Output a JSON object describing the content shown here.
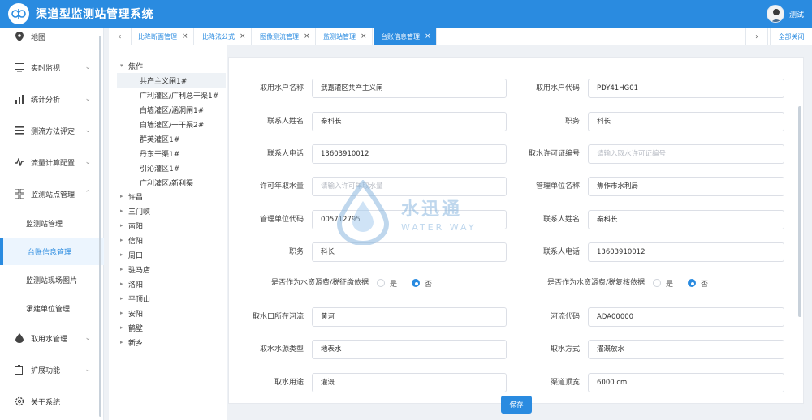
{
  "header": {
    "title": "渠道型监测站管理系统",
    "user_name": "测试"
  },
  "sidebar": {
    "items": [
      {
        "label": "地图",
        "icon": "map-pin-icon"
      },
      {
        "label": "实时监视",
        "icon": "monitor-icon"
      },
      {
        "label": "统计分析",
        "icon": "chart-icon"
      },
      {
        "label": "测流方法评定",
        "icon": "list-icon"
      },
      {
        "label": "流量计算配置",
        "icon": "wave-icon"
      },
      {
        "label": "监测站点管理",
        "icon": "grid-icon"
      },
      {
        "label": "取用水管理",
        "icon": "drop-icon"
      },
      {
        "label": "扩展功能",
        "icon": "extension-icon"
      },
      {
        "label": "关于系统",
        "icon": "gear-icon"
      }
    ],
    "sub_items": [
      {
        "label": "监测站管理"
      },
      {
        "label": "台账信息管理"
      },
      {
        "label": "监测站现场图片"
      },
      {
        "label": "承建单位管理"
      }
    ]
  },
  "tabs": {
    "items": [
      {
        "label": "比降断面管理"
      },
      {
        "label": "比降法公式"
      },
      {
        "label": "图像测流管理"
      },
      {
        "label": "监测站管理"
      },
      {
        "label": "台账信息管理"
      }
    ],
    "close_all": "全部关闭"
  },
  "tree": {
    "root": "焦作",
    "children": [
      "共产主义闸1#",
      "广利灌区/广利总干渠1#",
      "白墙灌区/涵洞闸1#",
      "白墙灌区/一干渠2#",
      "群英灌区1#",
      "丹东干渠1#",
      "引沁灌区1#",
      "广利灌区/新利渠"
    ],
    "others": [
      "许昌",
      "三门峡",
      "南阳",
      "信阳",
      "周口",
      "驻马店",
      "洛阳",
      "平顶山",
      "安阳",
      "鹤壁",
      "新乡"
    ]
  },
  "form": {
    "intake_name_label": "取用水户名称",
    "intake_name": "武嘉灌区共产主义闸",
    "intake_code_label": "取用水户代码",
    "intake_code": "PDY41HG01",
    "contact_name_label": "联系人姓名",
    "contact_name": "秦科长",
    "position_label": "职务",
    "position": "科长",
    "contact_phone_label": "联系人电话",
    "contact_phone": "13603910012",
    "permit_no_label": "取水许可证编号",
    "permit_no_placeholder": "请输入取水许可证编号",
    "permit_annual_label": "许可年取水量",
    "permit_annual_placeholder": "请输入许可年取水量",
    "mgmt_unit_label": "管理单位名称",
    "mgmt_unit": "焦作市水利局",
    "mgmt_code_label": "管理单位代码",
    "mgmt_code": "005712795",
    "contact_name2_label": "联系人姓名",
    "contact_name2": "秦科长",
    "position2_label": "职务",
    "position2": "科长",
    "contact_phone2_label": "联系人电话",
    "contact_phone2": "13603910012",
    "fee_basis_label": "是否作为水资源费/税征缴依据",
    "review_basis_label": "是否作为水资源费/税复核依据",
    "yes": "是",
    "no": "否",
    "river_label": "取水口所在河流",
    "river": "黄河",
    "river_code_label": "河流代码",
    "river_code": "ADA00000",
    "source_type_label": "取水水源类型",
    "source_type": "地表水",
    "method_label": "取水方式",
    "method": "灌溉放水",
    "purpose_label": "取水用途",
    "purpose": "灌溉",
    "channel_width_label": "渠道顶宽",
    "channel_width": "6000 cm"
  },
  "save_label": "保存",
  "watermark": {
    "cn": "水迅通",
    "en": "WATER WAY"
  },
  "colors": {
    "primary": "#2a8be0"
  }
}
